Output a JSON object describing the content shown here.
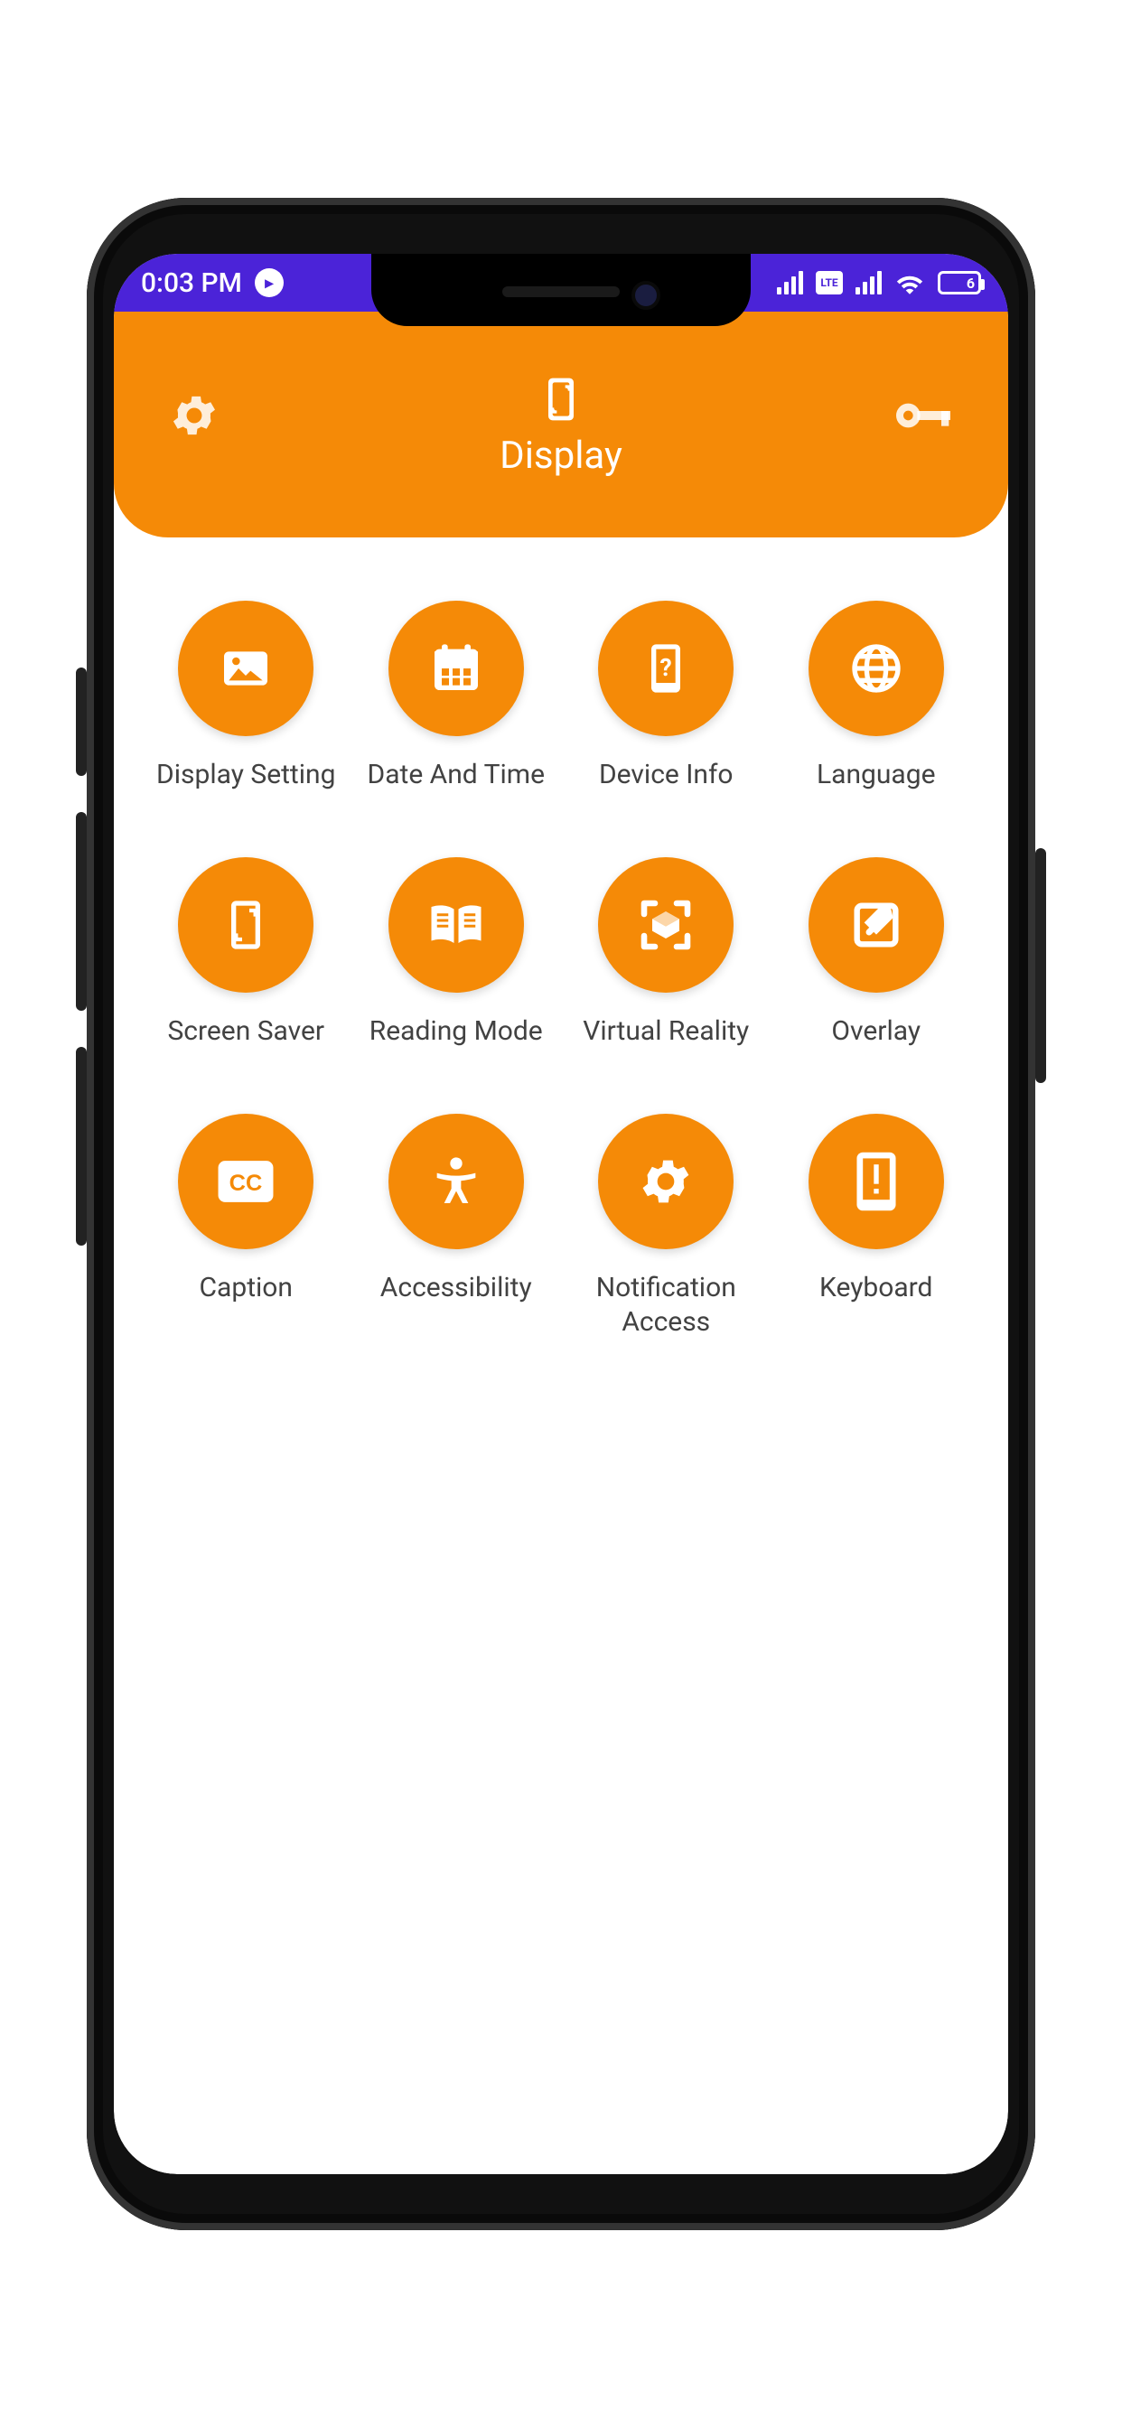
{
  "statusbar": {
    "time": "0:03 PM",
    "recording_badge": "⦿",
    "lte": "Vo LTE",
    "battery": "6"
  },
  "header": {
    "title": "Display"
  },
  "tiles": [
    {
      "label": "Display Setting"
    },
    {
      "label": "Date And Time"
    },
    {
      "label": "Device Info"
    },
    {
      "label": "Language"
    },
    {
      "label": "Screen Saver"
    },
    {
      "label": "Reading Mode"
    },
    {
      "label": "Virtual Reality"
    },
    {
      "label": "Overlay"
    },
    {
      "label": "Caption"
    },
    {
      "label": "Accessibility"
    },
    {
      "label": "Notification Access"
    },
    {
      "label": "Keyboard"
    }
  ]
}
